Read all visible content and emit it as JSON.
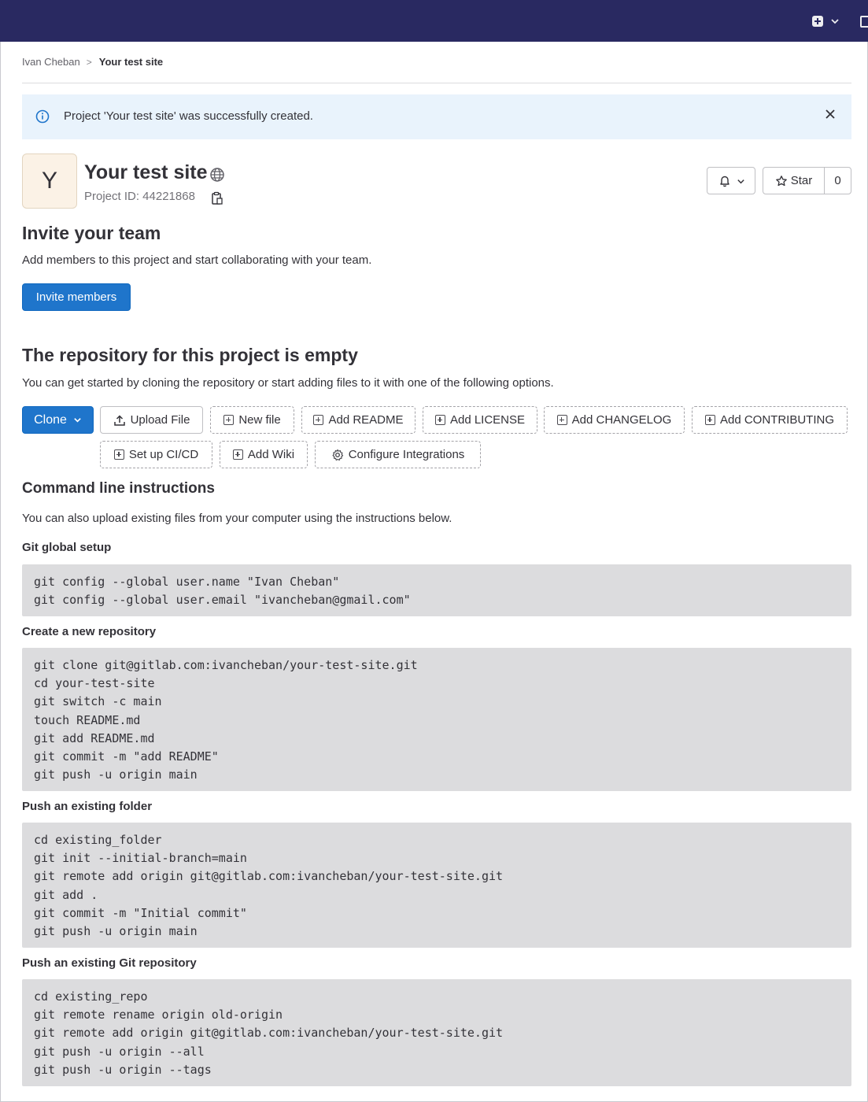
{
  "breadcrumb": {
    "user": "Ivan Cheban",
    "separator": ">",
    "current": "Your test site"
  },
  "alert": {
    "message": "Project 'Your test site' was successfully created."
  },
  "project": {
    "avatar_letter": "Y",
    "title": "Your test site",
    "id_label": "Project ID: 44221868"
  },
  "actions": {
    "star_label": "Star",
    "star_count": "0"
  },
  "invite": {
    "heading": "Invite your team",
    "description": "Add members to this project and start collaborating with your team.",
    "button": "Invite members"
  },
  "empty_repo": {
    "heading": "The repository for this project is empty",
    "description": "You can get started by cloning the repository or start adding files to it with one of the following options.",
    "clone_button": "Clone",
    "upload_button": "Upload File",
    "add_buttons": [
      "New file",
      "Add README",
      "Add LICENSE",
      "Add CHANGELOG",
      "Add CONTRIBUTING",
      "Set up CI/CD",
      "Add Wiki"
    ],
    "integrations_button": "Configure Integrations"
  },
  "command_line": {
    "heading": "Command line instructions",
    "description": "You can also upload existing files from your computer using the instructions below.",
    "sections": [
      {
        "title": "Git global setup",
        "lines": [
          "git config --global user.name \"Ivan Cheban\"",
          "git config --global user.email \"ivancheban@gmail.com\""
        ]
      },
      {
        "title": "Create a new repository",
        "lines": [
          "git clone git@gitlab.com:ivancheban/your-test-site.git",
          "cd your-test-site",
          "git switch -c main",
          "touch README.md",
          "git add README.md",
          "git commit -m \"add README\"",
          "git push -u origin main"
        ]
      },
      {
        "title": "Push an existing folder",
        "lines": [
          "cd existing_folder",
          "git init --initial-branch=main",
          "git remote add origin git@gitlab.com:ivancheban/your-test-site.git",
          "git add .",
          "git commit -m \"Initial commit\"",
          "git push -u origin main"
        ]
      },
      {
        "title": "Push an existing Git repository",
        "lines": [
          "cd existing_repo",
          "git remote rename origin old-origin",
          "git remote add origin git@gitlab.com:ivancheban/your-test-site.git",
          "git push -u origin --all",
          "git push -u origin --tags"
        ]
      }
    ]
  }
}
